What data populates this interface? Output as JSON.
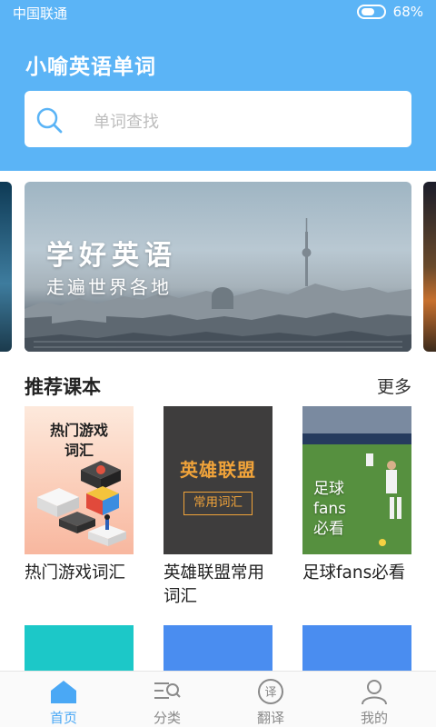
{
  "status_bar": {
    "carrier": "中国联通",
    "battery": "68%"
  },
  "app": {
    "title": "小喻英语单词"
  },
  "search": {
    "placeholder": "单词查找",
    "icon": "search-icon"
  },
  "banner": {
    "title": "学好英语",
    "subtitle": "走遍世界各地"
  },
  "section": {
    "title": "推荐课本",
    "more": "更多"
  },
  "books": [
    {
      "name": "热门游戏词汇",
      "cover_text": "热门游戏\n词汇"
    },
    {
      "name": "英雄联盟常用词汇",
      "cover_title": "英雄联盟",
      "cover_tag": "常用词汇"
    },
    {
      "name": "足球fans必看",
      "cover_text": "足球\nfans\n必看"
    }
  ],
  "next_row_colors": [
    "#1cc8c8",
    "#4a8df0",
    "#4a8df0"
  ],
  "tabs": [
    {
      "label": "首页",
      "icon": "home-icon",
      "active": true
    },
    {
      "label": "分类",
      "icon": "category-icon",
      "active": false
    },
    {
      "label": "翻译",
      "icon": "translate-icon",
      "active": false
    },
    {
      "label": "我的",
      "icon": "profile-icon",
      "active": false
    }
  ],
  "colors": {
    "primary": "#5bb4f6",
    "tab_active": "#4aa8f5",
    "lol_accent": "#f0a33a"
  }
}
